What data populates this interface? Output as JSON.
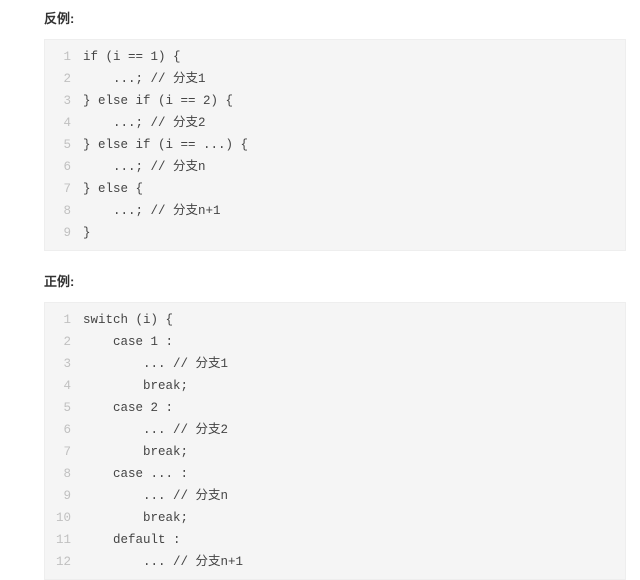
{
  "sections": {
    "bad": {
      "label": "反例:",
      "code_lines": [
        "if (i == 1) {",
        "    ...; // 分支1",
        "} else if (i == 2) {",
        "    ...; // 分支2",
        "} else if (i == ...) {",
        "    ...; // 分支n",
        "} else {",
        "    ...; // 分支n+1",
        "}"
      ]
    },
    "good": {
      "label": "正例:",
      "code_lines": [
        "switch (i) {",
        "    case 1 :",
        "        ... // 分支1",
        "        break;",
        "    case 2 :",
        "        ... // 分支2",
        "        break;",
        "    case ... :",
        "        ... // 分支n",
        "        break;",
        "    default :",
        "        ... // 分支n+1"
      ]
    }
  }
}
